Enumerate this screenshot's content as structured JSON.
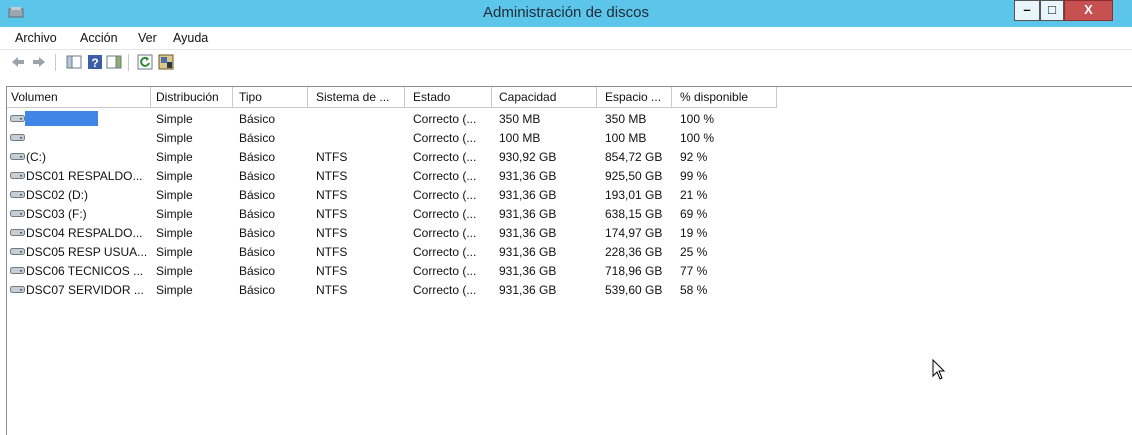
{
  "window": {
    "title": "Administración de discos",
    "min_glyph": "–",
    "max_glyph": "□",
    "close_glyph": "X"
  },
  "menu": [
    "Archivo",
    "Acción",
    "Ver",
    "Ayuda"
  ],
  "toolbar": [
    "back-icon",
    "forward-icon",
    "console-tree-icon",
    "help-icon",
    "action-pane-icon",
    "refresh-icon",
    "properties-icon"
  ],
  "columns": [
    "Volumen",
    "Distribución",
    "Tipo",
    "Sistema de ...",
    "Estado",
    "Capacidad",
    "Espacio ...",
    "% disponible"
  ],
  "rows": [
    {
      "volume": "",
      "selected": true,
      "layout": "Simple",
      "type": "Básico",
      "fs": "",
      "status": "Correcto (...",
      "capacity": "350 MB",
      "free": "350 MB",
      "pct": "100 %"
    },
    {
      "volume": "",
      "selected": false,
      "layout": "Simple",
      "type": "Básico",
      "fs": "",
      "status": "Correcto (...",
      "capacity": "100 MB",
      "free": "100 MB",
      "pct": "100 %"
    },
    {
      "volume": "(C:)",
      "selected": false,
      "layout": "Simple",
      "type": "Básico",
      "fs": "NTFS",
      "status": "Correcto (...",
      "capacity": "930,92 GB",
      "free": "854,72 GB",
      "pct": "92 %"
    },
    {
      "volume": "DSC01 RESPALDO...",
      "selected": false,
      "layout": "Simple",
      "type": "Básico",
      "fs": "NTFS",
      "status": "Correcto (...",
      "capacity": "931,36 GB",
      "free": "925,50 GB",
      "pct": "99 %"
    },
    {
      "volume": "DSC02 (D:)",
      "selected": false,
      "layout": "Simple",
      "type": "Básico",
      "fs": "NTFS",
      "status": "Correcto (...",
      "capacity": "931,36 GB",
      "free": "193,01 GB",
      "pct": "21 %"
    },
    {
      "volume": "DSC03 (F:)",
      "selected": false,
      "layout": "Simple",
      "type": "Básico",
      "fs": "NTFS",
      "status": "Correcto (...",
      "capacity": "931,36 GB",
      "free": "638,15 GB",
      "pct": "69 %"
    },
    {
      "volume": "DSC04 RESPALDO...",
      "selected": false,
      "layout": "Simple",
      "type": "Básico",
      "fs": "NTFS",
      "status": "Correcto (...",
      "capacity": "931,36 GB",
      "free": "174,97 GB",
      "pct": "19 %"
    },
    {
      "volume": "DSC05 RESP USUA...",
      "selected": false,
      "layout": "Simple",
      "type": "Básico",
      "fs": "NTFS",
      "status": "Correcto (...",
      "capacity": "931,36 GB",
      "free": "228,36 GB",
      "pct": "25 %"
    },
    {
      "volume": "DSC06 TECNICOS ...",
      "selected": false,
      "layout": "Simple",
      "type": "Básico",
      "fs": "NTFS",
      "status": "Correcto (...",
      "capacity": "931,36 GB",
      "free": "718,96 GB",
      "pct": "77 %"
    },
    {
      "volume": "DSC07 SERVIDOR ...",
      "selected": false,
      "layout": "Simple",
      "type": "Básico",
      "fs": "NTFS",
      "status": "Correcto (...",
      "capacity": "931,36 GB",
      "free": "539,60 GB",
      "pct": "58 %"
    }
  ],
  "colors": {
    "titlebar": "#5cc6ea",
    "selection": "#3f86e6",
    "close": "#c75050"
  }
}
